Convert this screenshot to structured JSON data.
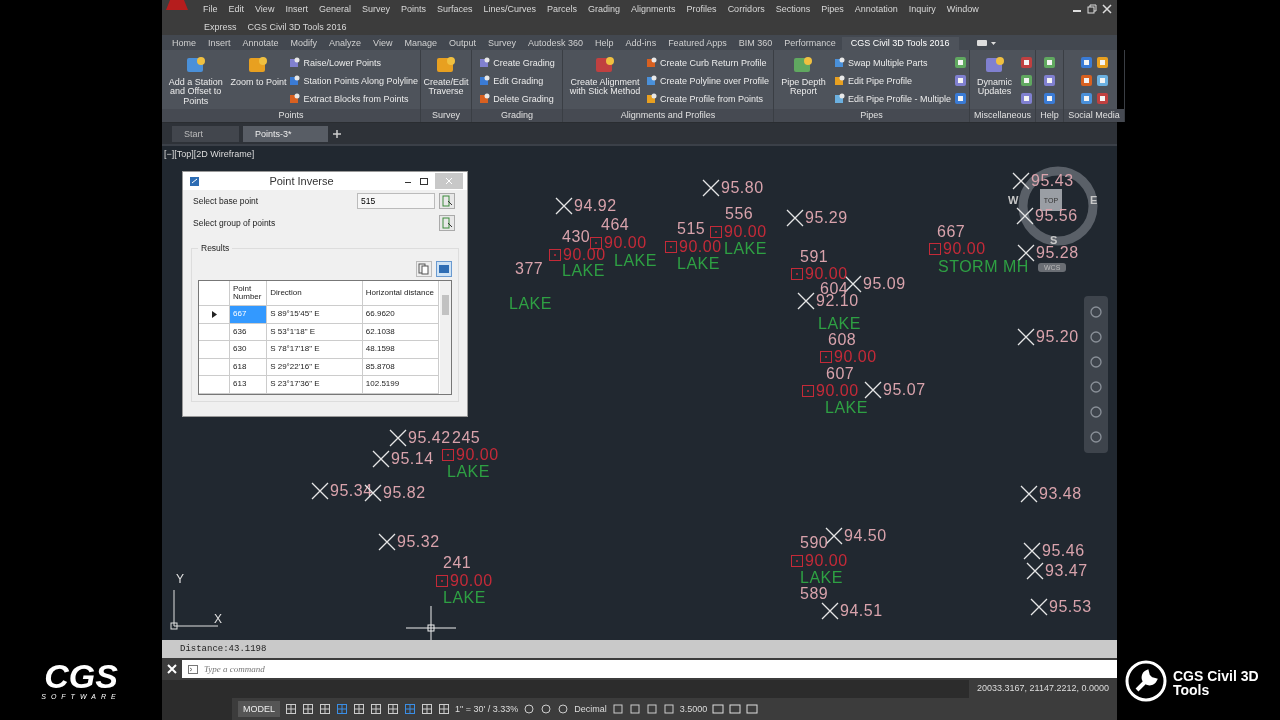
{
  "brand_left": {
    "name": "CGS",
    "tagline": "SOFTWARE"
  },
  "brand_right": {
    "line1": "CGS Civil 3D",
    "line2": "Tools"
  },
  "menu_bar": {
    "row1": [
      "File",
      "Edit",
      "View",
      "Insert",
      "General",
      "Survey",
      "Points",
      "Surfaces",
      "Lines/Curves",
      "Parcels",
      "Grading",
      "Alignments",
      "Profiles",
      "Corridors",
      "Sections",
      "Pipes",
      "Annotation",
      "Inquiry",
      "Window"
    ],
    "row2": [
      "Express",
      "CGS Civil 3D Tools 2016"
    ]
  },
  "ribbon_tabs": [
    {
      "label": "Home",
      "selected": false
    },
    {
      "label": "Insert",
      "selected": false
    },
    {
      "label": "Annotate",
      "selected": false
    },
    {
      "label": "Modify",
      "selected": false
    },
    {
      "label": "Analyze",
      "selected": false
    },
    {
      "label": "View",
      "selected": false
    },
    {
      "label": "Manage",
      "selected": false
    },
    {
      "label": "Output",
      "selected": false
    },
    {
      "label": "Survey",
      "selected": false
    },
    {
      "label": "Autodesk 360",
      "selected": false
    },
    {
      "label": "Help",
      "selected": false
    },
    {
      "label": "Add-ins",
      "selected": false
    },
    {
      "label": "Featured Apps",
      "selected": false
    },
    {
      "label": "BIM 360",
      "selected": false
    },
    {
      "label": "Performance",
      "selected": false
    },
    {
      "label": "CGS Civil 3D Tools 2016",
      "selected": true
    }
  ],
  "ribbon_panels": [
    {
      "title": "Points",
      "tools": [
        {
          "kind": "large",
          "label": "Add a Station and Offset to Points"
        },
        {
          "kind": "large",
          "label": "Zoom to Point"
        },
        {
          "kind": "small",
          "label": "Raise/Lower Points"
        },
        {
          "kind": "small",
          "label": "Station Points Along Polyline"
        },
        {
          "kind": "small",
          "label": "Extract Blocks from Points"
        }
      ]
    },
    {
      "title": "Survey",
      "tools": [
        {
          "kind": "large",
          "label": "Create/Edit Traverse"
        }
      ]
    },
    {
      "title": "Grading",
      "tools": [
        {
          "kind": "small",
          "label": "Create Grading"
        },
        {
          "kind": "small",
          "label": "Edit Grading"
        },
        {
          "kind": "small",
          "label": "Delete Grading"
        }
      ]
    },
    {
      "title": "Alignments and Profiles",
      "tools": [
        {
          "kind": "large",
          "label": "Create Alignment with Stick Method"
        },
        {
          "kind": "small",
          "label": "Create Curb Return Profile"
        },
        {
          "kind": "small",
          "label": "Create Polyline over Profile"
        },
        {
          "kind": "small",
          "label": "Create Profile from Points"
        }
      ]
    },
    {
      "title": "Pipes",
      "tools": [
        {
          "kind": "large",
          "label": "Pipe Depth Report"
        },
        {
          "kind": "small",
          "label": "Swap Multiple Parts"
        },
        {
          "kind": "small",
          "label": "Edit Pipe Profile"
        },
        {
          "kind": "small",
          "label": "Edit Pipe Profile - Multiple"
        },
        {
          "kind": "icon"
        },
        {
          "kind": "icon"
        },
        {
          "kind": "icon"
        }
      ]
    },
    {
      "title": "Miscellaneous",
      "tools": [
        {
          "kind": "large",
          "label": "Dynamic Updates"
        },
        {
          "kind": "icon"
        },
        {
          "kind": "icon"
        },
        {
          "kind": "icon"
        }
      ]
    },
    {
      "title": "Help",
      "tools": [
        {
          "kind": "icon"
        },
        {
          "kind": "icon"
        },
        {
          "kind": "icon"
        }
      ]
    },
    {
      "title": "Social Media",
      "tools": [
        {
          "kind": "icon"
        },
        {
          "kind": "icon"
        },
        {
          "kind": "icon"
        },
        {
          "kind": "icon"
        },
        {
          "kind": "icon"
        },
        {
          "kind": "icon"
        }
      ]
    }
  ],
  "file_tabs": [
    {
      "label": "Start",
      "selected": false
    },
    {
      "label": "Points-3*",
      "selected": true
    }
  ],
  "viewport_label": "[−][Top][2D Wireframe]",
  "dialog": {
    "title": "Point Inverse",
    "base_label": "Select base point",
    "base_value": "515",
    "group_label": "Select group of points",
    "results_label": "Results",
    "columns": [
      "Point Number",
      "Direction",
      "Horizontal distance"
    ],
    "rows": [
      {
        "cells": [
          "667",
          "S 89°15'45\" E",
          "66.9620"
        ],
        "selected": true
      },
      {
        "cells": [
          "636",
          "S 53°1'18\" E",
          "62.1038"
        ],
        "selected": false
      },
      {
        "cells": [
          "630",
          "S 78°17'18\" E",
          "48.1598"
        ],
        "selected": false
      },
      {
        "cells": [
          "618",
          "S 29°22'16\" E",
          "85.8708"
        ],
        "selected": false
      },
      {
        "cells": [
          "613",
          "S 23°17'36\" E",
          "102.5199"
        ],
        "selected": false
      }
    ]
  },
  "canvas_labels": [
    {
      "kind": "elevation",
      "text": "95.80"
    },
    {
      "kind": "elevation",
      "text": "94.92"
    },
    {
      "kind": "elevation",
      "text": "95.29"
    },
    {
      "kind": "elevation",
      "text": "95.09"
    },
    {
      "kind": "elevation",
      "text": "92.10"
    },
    {
      "kind": "elevation",
      "text": "95.07"
    },
    {
      "kind": "elevation",
      "text": "95.42"
    },
    {
      "kind": "elevation",
      "text": "95.14"
    },
    {
      "kind": "elevation",
      "text": "95.34"
    },
    {
      "kind": "elevation",
      "text": "95.82"
    },
    {
      "kind": "elevation",
      "text": "95.32"
    },
    {
      "kind": "elevation",
      "text": "94.50"
    },
    {
      "kind": "elevation",
      "text": "94.51"
    },
    {
      "kind": "elevation",
      "text": "95.43"
    },
    {
      "kind": "elevation",
      "text": "95.56"
    },
    {
      "kind": "elevation",
      "text": "95.28"
    },
    {
      "kind": "elevation",
      "text": "95.20"
    },
    {
      "kind": "elevation",
      "text": "93.48"
    },
    {
      "kind": "elevation",
      "text": "95.46"
    },
    {
      "kind": "elevation",
      "text": "93.47"
    },
    {
      "kind": "elevation",
      "text": "95.53"
    },
    {
      "kind": "number",
      "text": "430"
    },
    {
      "kind": "number",
      "text": "464"
    },
    {
      "kind": "number",
      "text": "515"
    },
    {
      "kind": "number",
      "text": "556"
    },
    {
      "kind": "number",
      "text": "377"
    },
    {
      "kind": "number",
      "text": "591"
    },
    {
      "kind": "number",
      "text": "604"
    },
    {
      "kind": "number",
      "text": "608"
    },
    {
      "kind": "number",
      "text": "607"
    },
    {
      "kind": "number",
      "text": "667"
    },
    {
      "kind": "number",
      "text": "245"
    },
    {
      "kind": "number",
      "text": "241"
    },
    {
      "kind": "number",
      "text": "590"
    },
    {
      "kind": "number",
      "text": "589"
    },
    {
      "kind": "tag",
      "text": "90.00"
    },
    {
      "kind": "tag",
      "text": "90.00"
    },
    {
      "kind": "tag",
      "text": "90.00"
    },
    {
      "kind": "tag",
      "text": "90.00"
    },
    {
      "kind": "tag",
      "text": "90.00"
    },
    {
      "kind": "tag",
      "text": "90.00"
    },
    {
      "kind": "tag",
      "text": "90.00"
    },
    {
      "kind": "tag",
      "text": "90.00"
    },
    {
      "kind": "tag",
      "text": "90.00"
    },
    {
      "kind": "tag",
      "text": "90.00"
    },
    {
      "kind": "tag",
      "text": "90.00"
    },
    {
      "kind": "description",
      "text": "LAKE"
    },
    {
      "kind": "description",
      "text": "LAKE"
    },
    {
      "kind": "description",
      "text": "LAKE"
    },
    {
      "kind": "description",
      "text": "LAKE"
    },
    {
      "kind": "description",
      "text": "LAKE"
    },
    {
      "kind": "description",
      "text": "LAKE"
    },
    {
      "kind": "description",
      "text": "LAKE"
    },
    {
      "kind": "description",
      "text": "LAKE"
    },
    {
      "kind": "description",
      "text": "LAKE"
    },
    {
      "kind": "description",
      "text": "LAKE"
    },
    {
      "kind": "description",
      "text": "STORM MH"
    }
  ],
  "view_cube": {
    "west": "W",
    "east": "E",
    "south": "S",
    "face": "TOP",
    "ucs": "WCS"
  },
  "ucs_axes": {
    "x": "X",
    "y": "Y"
  },
  "command_line": {
    "history": "Distance:43.1198",
    "placeholder": "Type a command"
  },
  "status_bar": {
    "coordinates": "20033.3167, 21147.2212, 0.0000",
    "model": "MODEL",
    "scale": "1\" = 30' / 3.33%",
    "units": "Decimal",
    "value": "3.5000"
  }
}
